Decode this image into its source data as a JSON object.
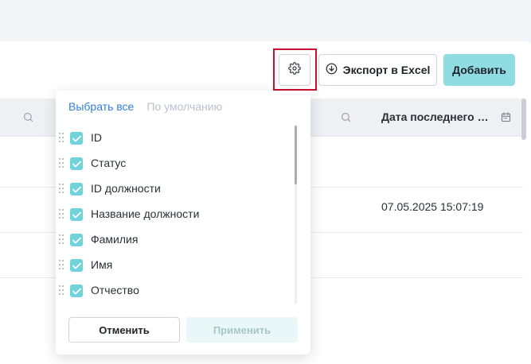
{
  "toolbar": {
    "settings_icon": "gear-icon",
    "export_label": "Экспорт в Excel",
    "export_icon": "download-circle-icon",
    "add_label": "Добавить",
    "highlight_color": "#c8102e",
    "accent_color": "#8fdde3"
  },
  "table": {
    "columns": {
      "last_date_label": "Дата последнего ус..."
    },
    "rows": [
      {
        "date": ""
      },
      {
        "date": "07.05.2025 15:07:19"
      },
      {
        "date": ""
      }
    ]
  },
  "column_picker": {
    "select_all_label": "Выбрать все",
    "default_label": "По умолчанию",
    "items": [
      {
        "label": "ID",
        "checked": true
      },
      {
        "label": "Статус",
        "checked": true
      },
      {
        "label": "ID должности",
        "checked": true
      },
      {
        "label": "Название должности",
        "checked": true
      },
      {
        "label": "Фамилия",
        "checked": true
      },
      {
        "label": "Имя",
        "checked": true
      },
      {
        "label": "Отчество",
        "checked": true
      }
    ],
    "cancel_label": "Отменить",
    "apply_label": "Применить",
    "checkbox_color": "#6ed3db"
  }
}
